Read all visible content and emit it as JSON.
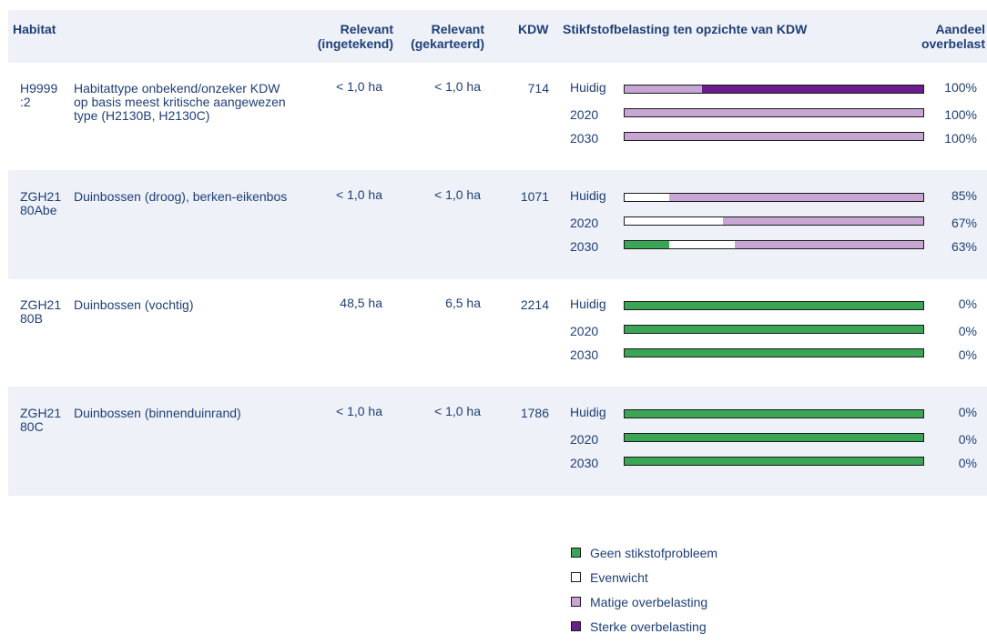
{
  "header": {
    "habitat": "Habitat",
    "relevant_ingetekend_1": "Relevant",
    "relevant_ingetekend_2": "(ingetekend)",
    "relevant_gekarteerd_1": "Relevant",
    "relevant_gekarteerd_2": "(gekarteerd)",
    "kdw": "KDW",
    "stikstof": "Stikfstofbelasting ten opzichte van KDW",
    "aandeel_1": "Aandeel",
    "aandeel_2": "overbelast"
  },
  "colors": {
    "geen": "#3aa655",
    "evenwicht": "#ffffff",
    "matig": "#c7a6d4",
    "sterk": "#6a1d8c"
  },
  "rows": [
    {
      "code": "H9999 :2",
      "name": "Habitattype onbekend/onzeker KDW op basis meest kritische aangewezen type (H2130B, H2130C)",
      "relevant_ingetekend": "< 1,0 ha",
      "relevant_gekarteerd": "< 1,0 ha",
      "kdw": "714",
      "bars": [
        {
          "label": "Huidig",
          "pct": "100%",
          "segments": [
            {
              "cls": "matig",
              "f": 0.26
            },
            {
              "cls": "sterk",
              "f": 0.74
            }
          ]
        },
        {
          "label": "2020",
          "pct": "100%",
          "segments": [
            {
              "cls": "matig",
              "f": 1.0
            }
          ]
        },
        {
          "label": "2030",
          "pct": "100%",
          "segments": [
            {
              "cls": "matig",
              "f": 1.0
            }
          ]
        }
      ]
    },
    {
      "code": "ZGH21 80Abe",
      "name": "Duinbossen (droog), berken-eikenbos",
      "relevant_ingetekend": "< 1,0 ha",
      "relevant_gekarteerd": "< 1,0 ha",
      "kdw": "1071",
      "bars": [
        {
          "label": "Huidig",
          "pct": "85%",
          "segments": [
            {
              "cls": "evenwicht",
              "f": 0.15
            },
            {
              "cls": "matig",
              "f": 0.85
            }
          ]
        },
        {
          "label": "2020",
          "pct": "67%",
          "segments": [
            {
              "cls": "evenwicht",
              "f": 0.33
            },
            {
              "cls": "matig",
              "f": 0.67
            }
          ]
        },
        {
          "label": "2030",
          "pct": "63%",
          "segments": [
            {
              "cls": "geen",
              "f": 0.15
            },
            {
              "cls": "evenwicht",
              "f": 0.22
            },
            {
              "cls": "matig",
              "f": 0.63
            }
          ]
        }
      ]
    },
    {
      "code": "ZGH21 80B",
      "name": "Duinbossen (vochtig)",
      "relevant_ingetekend": "48,5 ha",
      "relevant_gekarteerd": "6,5 ha",
      "kdw": "2214",
      "bars": [
        {
          "label": "Huidig",
          "pct": "0%",
          "segments": [
            {
              "cls": "geen",
              "f": 1.0
            }
          ]
        },
        {
          "label": "2020",
          "pct": "0%",
          "segments": [
            {
              "cls": "geen",
              "f": 1.0
            }
          ]
        },
        {
          "label": "2030",
          "pct": "0%",
          "segments": [
            {
              "cls": "geen",
              "f": 1.0
            }
          ]
        }
      ]
    },
    {
      "code": "ZGH21 80C",
      "name": "Duinbossen (binnenduinrand)",
      "relevant_ingetekend": "< 1,0 ha",
      "relevant_gekarteerd": "< 1,0 ha",
      "kdw": "1786",
      "bars": [
        {
          "label": "Huidig",
          "pct": "0%",
          "segments": [
            {
              "cls": "geen",
              "f": 1.0
            }
          ]
        },
        {
          "label": "2020",
          "pct": "0%",
          "segments": [
            {
              "cls": "geen",
              "f": 1.0
            }
          ]
        },
        {
          "label": "2030",
          "pct": "0%",
          "segments": [
            {
              "cls": "geen",
              "f": 1.0
            }
          ]
        }
      ]
    }
  ],
  "legend": [
    {
      "cls": "geen",
      "label": "Geen stikstofprobleem"
    },
    {
      "cls": "evenwicht",
      "label": "Evenwicht"
    },
    {
      "cls": "matig",
      "label": "Matige overbelasting"
    },
    {
      "cls": "sterk",
      "label": "Sterke overbelasting"
    }
  ]
}
